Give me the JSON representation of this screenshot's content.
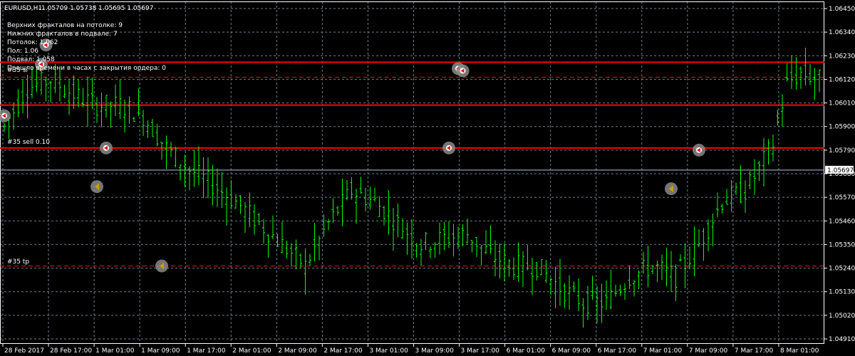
{
  "header": {
    "symbol_tf": "EURUSD,H1",
    "ohlc": "1.05709 1.05738 1.05695 1.05697"
  },
  "info": [
    "Верхних фракталов на потолке: 9",
    "Нижних фракталов в подвале: 7",
    "Потолок: 1.062",
    "Пол: 1.06",
    "Подвал: 1.058",
    "Прошло времени в часах с закрытия ордера: 0"
  ],
  "orders": {
    "sell_label": "#35 sell 0.10",
    "tp_label": "#35 tp",
    "sl_label": "#35 sl"
  },
  "current_price_label": "1.05697",
  "colors": {
    "background": "#000000",
    "grid": "#6f7f8f",
    "candle": "#00ff00",
    "level_line": "#ff0000",
    "order_line": "#ff0000",
    "current_line": "#b0c4de",
    "fractal_circle": "#8a8a8a",
    "fractal_up_marker": "#ff0000",
    "fractal_down_marker": "#c8a000"
  },
  "chart_data": {
    "type": "candlestick",
    "symbol": "EURUSD",
    "timeframe": "H1",
    "ylim": [
      1.0491,
      1.065
    ],
    "y_ticks": [
      "1.06450",
      "1.06340",
      "1.06230",
      "1.06120",
      "1.06010",
      "1.05900",
      "1.05790",
      "1.05680",
      "1.05570",
      "1.05460",
      "1.05350",
      "1.05240",
      "1.05130",
      "1.05020",
      "1.04910"
    ],
    "x_ticks": [
      "28 Feb 2017",
      "28 Feb 17:00",
      "1 Mar 01:00",
      "1 Mar 09:00",
      "1 Mar 17:00",
      "2 Mar 01:00",
      "2 Mar 09:00",
      "2 Mar 17:00",
      "3 Mar 01:00",
      "3 Mar 09:00",
      "3 Mar 17:00",
      "6 Mar 01:00",
      "6 Mar 09:00",
      "6 Mar 17:00",
      "7 Mar 01:00",
      "7 Mar 09:00",
      "7 Mar 17:00",
      "8 Mar 01:00"
    ],
    "levels": {
      "ceiling": 1.062,
      "floor": 1.06,
      "basement": 1.058,
      "order_sl": 1.0613,
      "order_tp": 1.0525,
      "current": 1.05697
    },
    "bars_count": 177,
    "key_points": [
      [
        0,
        1.059
      ],
      [
        5,
        1.0608
      ],
      [
        10,
        1.0612
      ],
      [
        15,
        1.0605
      ],
      [
        20,
        1.06
      ],
      [
        25,
        1.06
      ],
      [
        30,
        1.0595
      ],
      [
        35,
        1.058
      ],
      [
        40,
        1.057
      ],
      [
        45,
        1.0563
      ],
      [
        50,
        1.0555
      ],
      [
        55,
        1.0545
      ],
      [
        60,
        1.0535
      ],
      [
        65,
        1.0525
      ],
      [
        70,
        1.0545
      ],
      [
        75,
        1.056
      ],
      [
        80,
        1.0555
      ],
      [
        85,
        1.0545
      ],
      [
        90,
        1.0535
      ],
      [
        95,
        1.0538
      ],
      [
        100,
        1.054
      ],
      [
        105,
        1.053
      ],
      [
        110,
        1.0525
      ],
      [
        115,
        1.0525
      ],
      [
        120,
        1.0515
      ],
      [
        125,
        1.0508
      ],
      [
        130,
        1.0508
      ],
      [
        135,
        1.052
      ],
      [
        140,
        1.0525
      ],
      [
        145,
        1.052
      ],
      [
        150,
        1.0535
      ],
      [
        155,
        1.0555
      ],
      [
        160,
        1.056
      ],
      [
        163,
        1.057
      ],
      [
        166,
        1.0582
      ],
      [
        169,
        1.061
      ],
      [
        172,
        1.0615
      ],
      [
        176,
        1.0612
      ]
    ],
    "key_points_b": [
      [
        0,
        1.0612
      ],
      [
        3,
        1.0608
      ],
      [
        6,
        1.0605
      ],
      [
        9,
        1.06
      ],
      [
        12,
        1.0597
      ],
      [
        15,
        1.0594
      ],
      [
        18,
        1.059
      ],
      [
        21,
        1.0588
      ],
      [
        24,
        1.0584
      ],
      [
        27,
        1.0582
      ],
      [
        30,
        1.058
      ],
      [
        33,
        1.058
      ],
      [
        36,
        1.0578
      ],
      [
        39,
        1.0584
      ],
      [
        42,
        1.0586
      ],
      [
        45,
        1.0578
      ],
      [
        48,
        1.0574
      ],
      [
        51,
        1.057
      ],
      [
        54,
        1.0568
      ],
      [
        57,
        1.0568
      ],
      [
        60,
        1.0566
      ],
      [
        63,
        1.0568
      ],
      [
        66,
        1.0566
      ],
      [
        70,
        1.0569
      ]
    ],
    "fractals_up": [
      {
        "bar": 0,
        "price": 1.0595
      },
      {
        "bar": 9,
        "price": 1.0628
      },
      {
        "bar": 8,
        "price": 1.0619
      },
      {
        "bar": 22,
        "price": 1.058
      },
      {
        "bar": 98,
        "price": 1.0617
      },
      {
        "bar": 99,
        "price": 1.0616
      },
      {
        "bar": 96,
        "price": 1.058
      },
      {
        "bar": 150,
        "price": 1.0579
      }
    ],
    "fractals_down": [
      {
        "bar": 20,
        "price": 1.0562
      },
      {
        "bar": 34,
        "price": 1.0525
      },
      {
        "bar": 144,
        "price": 1.0561
      }
    ]
  }
}
